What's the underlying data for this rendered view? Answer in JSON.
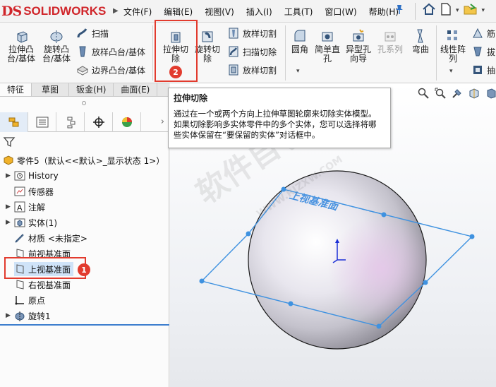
{
  "app": {
    "logo_prefix": "DS",
    "logo_text": "SOLIDWORKS"
  },
  "menu": [
    "文件(F)",
    "编辑(E)",
    "视图(V)",
    "插入(I)",
    "工具(T)",
    "窗口(W)",
    "帮助(H)"
  ],
  "ribbon": {
    "extrude_boss": "拉伸凸\n台/基体",
    "revolve_boss": "旋转凸\n台/基体",
    "sweep": "扫描",
    "loft_boss": "放样凸台/基体",
    "boundary_boss": "边界凸台/基体",
    "extrude_cut": "拉伸切\n除",
    "revolve_cut": "旋转切\n除",
    "loft_cut": "放样切割",
    "sweep_cut": "扫描切除",
    "boundary_cut": "放样切割",
    "fillet": "圆角",
    "simple_hole": "简单直\n孔",
    "hole_wizard": "异型孔\n向导",
    "hole_series": "孔系列",
    "bend": "弯曲",
    "linear_pattern": "线性阵\n列",
    "badge_2": "2"
  },
  "tabs": [
    "特征",
    "草图",
    "钣金(H)",
    "曲面(E)"
  ],
  "tooltip": {
    "title": "拉伸切除",
    "line1": "通过在一个或两个方向上拉伸草图轮廓来切除实体模型。",
    "line2": "如果切除影响多实体零件中的多个实体，您可以选择将哪",
    "line3": "些实体保留在“要保留的实体”对话框中。"
  },
  "tree": {
    "root": "零件5（默认<<默认>_显示状态 1>）",
    "history": "History",
    "sensors": "传感器",
    "annotations": "注解",
    "solid_bodies": "实体(1)",
    "material": "材质 <未指定>",
    "front_plane": "前视基准面",
    "top_plane": "上视基准面",
    "right_plane": "右视基准面",
    "origin": "原点",
    "revolve1": "旋转1",
    "badge_1": "1"
  },
  "viewport": {
    "plane_label": "上视基准面",
    "watermark": "软件自学网",
    "watermark_url": "WWW.RJZXW.COM"
  },
  "colors": {
    "accent": "#e23b2e",
    "plane": "#3f92e0",
    "logo": "#d0252a"
  }
}
